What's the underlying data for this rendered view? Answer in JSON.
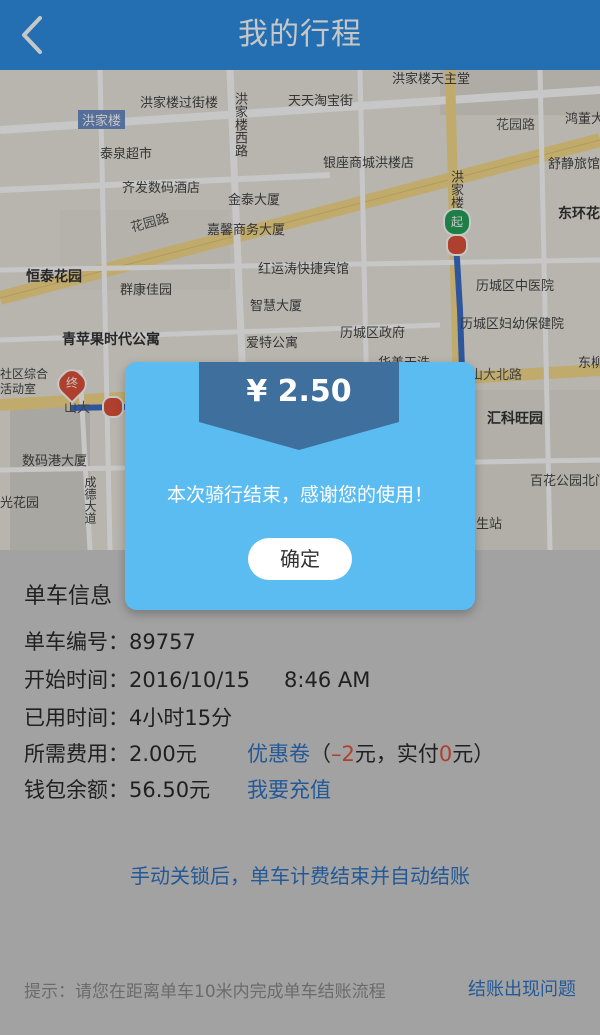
{
  "header": {
    "title": "我的行程",
    "back_icon": "chevron-left-icon"
  },
  "map": {
    "labels": [
      "洪家楼天主堂",
      "洪家楼过街楼",
      "天天淘宝街",
      "洪家楼",
      "花园路",
      "鸿董大厦",
      "泰泉超市",
      "洪家楼西路",
      "银座商城洪楼店",
      "舒静旅馆",
      "齐发数码酒店",
      "金泰大厦",
      "嘉馨商务大厦",
      "花园路",
      "洪家楼",
      "东环花",
      "恒泰花园",
      "红运涛快捷宾馆",
      "群康佳园",
      "智慧大厦",
      "历城区中医院",
      "青苹果时代公寓",
      "历城区政府",
      "爱特公寓",
      "历城区妇幼保健院",
      "东柳戏",
      "华美天洗",
      "山大北路",
      "汇科旺园",
      "山大",
      "社区综合活动室",
      "数码港大厦",
      "成德大道",
      "百花公园北门",
      "光花园",
      "生站"
    ],
    "start_marker": "起",
    "end_marker": "终"
  },
  "modal": {
    "price": "¥ 2.50",
    "message": "本次骑行结束，感谢您的使用！",
    "ok_label": "确定"
  },
  "info": {
    "section_title": "单车信息",
    "bike_no_label": "单车编号：",
    "bike_no": "89757",
    "start_time_label": "开始时间：",
    "start_date": "2016/10/15",
    "start_time": "8:46 AM",
    "used_time_label": "已用时间：",
    "used_time": "4小时15分",
    "fee_label": "所需费用：",
    "fee": "2.00元",
    "coupon_link": "优惠卷",
    "coupon_open": "（",
    "coupon_value": "–2",
    "coupon_mid": " 元，实付 ",
    "actual_value": "0",
    "coupon_close": " 元）",
    "wallet_label": "钱包余额：",
    "wallet": "56.50元",
    "recharge_link": "我要充值",
    "auto_note": "手动关锁后，单车计费结束并自动结账",
    "tip": "提示：请您在距离单车10米内完成单车结账流程",
    "problem_link": "结账出现问题"
  },
  "colors": {
    "header": "#2f8fe4",
    "modal": "#5bbcf1",
    "ribbon": "#3f6f9c",
    "link": "#2f72c2",
    "accent_red": "#e0533a"
  }
}
